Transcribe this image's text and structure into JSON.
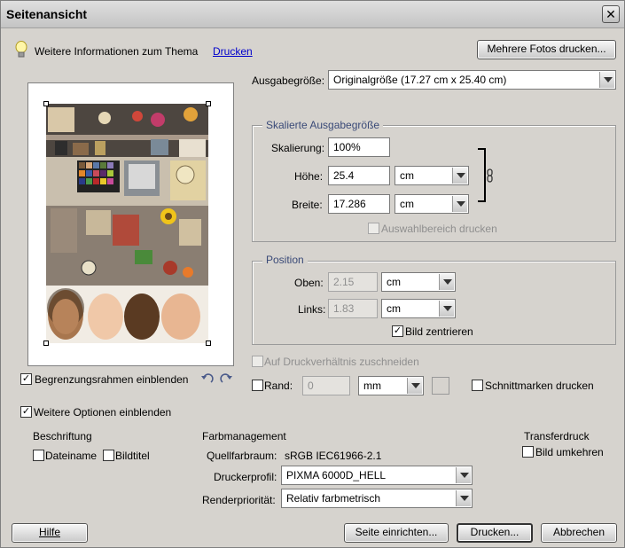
{
  "window": {
    "title": "Seitenansicht"
  },
  "info": {
    "text": "Weitere Informationen zum Thema",
    "link": "Drucken"
  },
  "buttons": {
    "multi_photo": "Mehrere Fotos drucken...",
    "help": "Hilfe",
    "page_setup": "Seite einrichten...",
    "print": "Drucken...",
    "cancel": "Abbrechen"
  },
  "output_size": {
    "label": "Ausgabegröße:",
    "value": "Originalgröße (17.27 cm x 25.40 cm)"
  },
  "scaled_group": {
    "legend": "Skalierte Ausgabegröße",
    "scale_label": "Skalierung:",
    "scale_value": "100%",
    "height_label": "Höhe:",
    "height_value": "25.4",
    "height_unit": "cm",
    "width_label": "Breite:",
    "width_value": "17.286",
    "width_unit": "cm",
    "selection_label": "Auswahlbereich drucken"
  },
  "position_group": {
    "legend": "Position",
    "top_label": "Oben:",
    "top_value": "2.15",
    "top_unit": "cm",
    "left_label": "Links:",
    "left_value": "1.83",
    "left_unit": "cm",
    "center_label": "Bild zentrieren"
  },
  "crop_label": "Auf Druckverhältnis zuschneiden",
  "border": {
    "label": "Rand:",
    "value": "0",
    "unit": "mm"
  },
  "crop_marks_label": "Schnittmarken drucken",
  "show_bbox_label": "Begrenzungsrahmen einblenden",
  "more_options_label": "Weitere Optionen einblenden",
  "labels_section": {
    "heading": "Beschriftung",
    "filename": "Dateiname",
    "title": "Bildtitel"
  },
  "color_mgmt": {
    "heading": "Farbmanagement",
    "source_label": "Quellfarbraum:",
    "source_value": "sRGB IEC61966-2.1",
    "printer_profile_label": "Druckerprofil:",
    "printer_profile_value": "PIXMA 6000D_HELL",
    "render_label": "Renderpriorität:",
    "render_value": "Relativ farbmetrisch"
  },
  "transfer": {
    "heading": "Transferdruck",
    "invert_label": "Bild umkehren"
  },
  "checks": {
    "show_bbox": true,
    "more_options": true,
    "center": true,
    "filename": false,
    "title": false,
    "invert": false,
    "border": false,
    "crop_marks": false,
    "crop": false,
    "selection": false
  },
  "icons": [
    "close-icon",
    "lightbulb-icon",
    "link-chain-icon",
    "rotate-left-icon",
    "rotate-right-icon",
    "color-swatch-icon"
  ]
}
